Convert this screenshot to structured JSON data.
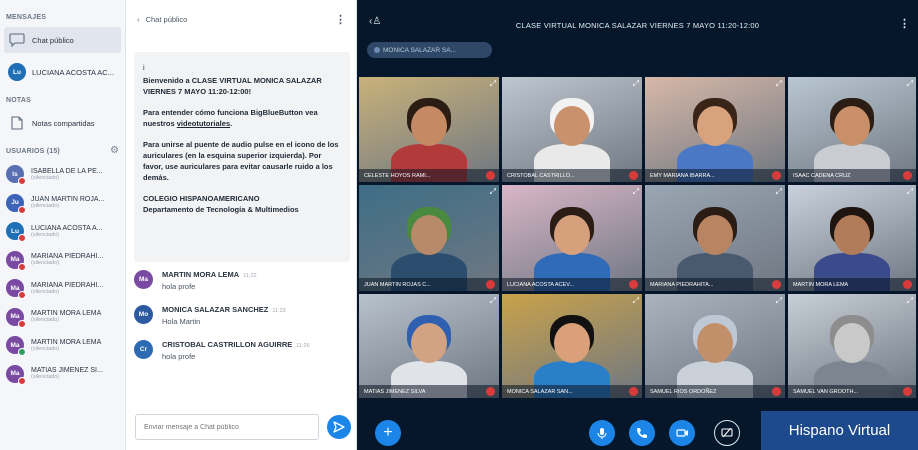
{
  "sidebar": {
    "messages_title": "MENSAJES",
    "public_chat_label": "Chat público",
    "pinned_user": {
      "initials": "Lu",
      "name": "LUCIANA ACOSTA AC...",
      "color": "#1e6fb5"
    },
    "notes_title": "NOTAS",
    "shared_notes_label": "Notas compartidas",
    "users_title": "USUARIOS (15)",
    "users": [
      {
        "initials": "Is",
        "name": "ISABELLA DE LA PE...",
        "status": "(silenciado)",
        "color": "#5a6fb1",
        "badge": "muted"
      },
      {
        "initials": "Ju",
        "name": "JUAN MARTIN ROJA...",
        "status": "(silenciado)",
        "color": "#3c63b8",
        "badge": "muted"
      },
      {
        "initials": "Lu",
        "name": "LUCIANA ACOSTA A...",
        "status": "(silenciado)",
        "color": "#1e6fb5",
        "badge": "muted"
      },
      {
        "initials": "Ma",
        "name": "MARIANA PIEDRAHI...",
        "status": "(silenciado)",
        "color": "#7a4aa3",
        "badge": "muted"
      },
      {
        "initials": "Ma",
        "name": "MARIANA PIEDRAHI...",
        "status": "(silenciado)",
        "color": "#7a4aa3",
        "badge": "muted"
      },
      {
        "initials": "Ma",
        "name": "MARTIN MORA LEMA",
        "status": "(silenciado)",
        "color": "#7a4aa3",
        "badge": "muted"
      },
      {
        "initials": "Ma",
        "name": "MARTIN MORA LEMA",
        "status": "(silenciado)",
        "color": "#7a4aa3",
        "badge": "talking"
      },
      {
        "initials": "Ma",
        "name": "MATIAS JIMENEZ SI...",
        "status": "(silenciado)",
        "color": "#7a4aa3",
        "badge": "muted"
      }
    ]
  },
  "chat": {
    "back_label": "Chat público",
    "menu_icon": "vertical-ellipsis-icon",
    "welcome": {
      "first_line": "i",
      "intro": "Bienvenido a ",
      "class_name": "CLASE VIRTUAL MONICA SALAZAR VIERNES 7 MAYO 11:20-12:00!",
      "tutorial_intro": "Para entender cómo funciona BigBlueButton vea nuestros ",
      "tutorial_link": "videotutoriales",
      "tutorial_end": ".",
      "audio_text": "Para unirse al puente de audio pulse en el icono de los auriculares (en la esquina superior izquierda). Por favor, use auriculares para evitar causarle ruido a los demás.",
      "school": "COLEGIO HISPANOAMERICANO",
      "department": "Departamento de Tecnología & Multimedios"
    },
    "messages": [
      {
        "initials": "Ma",
        "author": "MARTIN MORA LEMA",
        "time": "11:22",
        "text": "hola profe",
        "color": "#7a4aa3"
      },
      {
        "initials": "Mo",
        "author": "MONICA SALAZAR SANCHEZ",
        "time": "11:23",
        "text": "Hola Martin",
        "color": "#2c5aa0"
      },
      {
        "initials": "Cr",
        "author": "CRISTOBAL CASTRILLON AGUIRRE",
        "time": "11:26",
        "text": "hola profe",
        "color": "#2c6bb3"
      }
    ],
    "input_placeholder": "Enviar mensaje a Chat público"
  },
  "main": {
    "title": "CLASE VIRTUAL MONICA SALAZAR VIERNES 7 MAYO 11:20-12:00",
    "presenter_chip": "MONICA SALAZAR SA...",
    "tiles": [
      {
        "label": "CELESTE HOYOS RAMI...",
        "bg": "#c9b27a",
        "face": "#c48a63",
        "hair": "#2b1c14",
        "shirt": "#b33a3a"
      },
      {
        "label": "CRISTOBAL CASTRILLO...",
        "bg": "#bfc6cf",
        "face": "#c9916c",
        "hair": "#f2f2f2",
        "shirt": "#e9e9e9"
      },
      {
        "label": "EMY MARIANA IBARRA...",
        "bg": "#d7b8a8",
        "face": "#d8a27c",
        "hair": "#3a2418",
        "shirt": "#4a78c4"
      },
      {
        "label": "ISAAC CADENA CRUZ",
        "bg": "#b9c7d2",
        "face": "#c88f68",
        "hair": "#2b1c14",
        "shirt": "#c9cdd2"
      },
      {
        "label": "JUAN MARTIN ROJAS C...",
        "bg": "#3d6e86",
        "face": "#b98a6a",
        "hair": "#4a8a3f",
        "shirt": "#2c4e6e"
      },
      {
        "label": "LUCIANA ACOSTA ACEV...",
        "bg": "#d9b6c8",
        "face": "#d6a07d",
        "hair": "#2b1c14",
        "shirt": "#2f6bb7"
      },
      {
        "label": "MARIANA PIEDRAHITA...",
        "bg": "#9aa6b3",
        "face": "#b88462",
        "hair": "#2b1c14",
        "shirt": "#4a5a6e"
      },
      {
        "label": "MARTIN MORA LEMA",
        "bg": "#c9d2dc",
        "face": "#b27c5a",
        "hair": "#1e1410",
        "shirt": "#3a4a8a"
      },
      {
        "label": "MATIAS JIMENEZ SILVA",
        "bg": "#b8c2cc",
        "face": "#d1a383",
        "hair": "#2f5fb0",
        "shirt": "#e0e3e8"
      },
      {
        "label": "MONICA SALAZAR SAN...",
        "bg": "#c9a24a",
        "face": "#d9a07a",
        "hair": "#111111",
        "shirt": "#2b7fc9"
      },
      {
        "label": "SAMUEL RIOS ORDOÑEZ",
        "bg": "#aab3be",
        "face": "#c28f6b",
        "hair": "#bfc9d6",
        "shirt": "#c9d0d8"
      },
      {
        "label": "SAMUEL VAN GROOTH...",
        "bg": "#c8cfd6",
        "face": "#c9c9c9",
        "hair": "#8d8d8d",
        "shirt": "#7d8690"
      }
    ],
    "brand": "Hispano Virtual"
  },
  "colors": {
    "accent": "#1b86e8",
    "dark_bg": "#06172b",
    "muted_red": "#d93b3b"
  }
}
